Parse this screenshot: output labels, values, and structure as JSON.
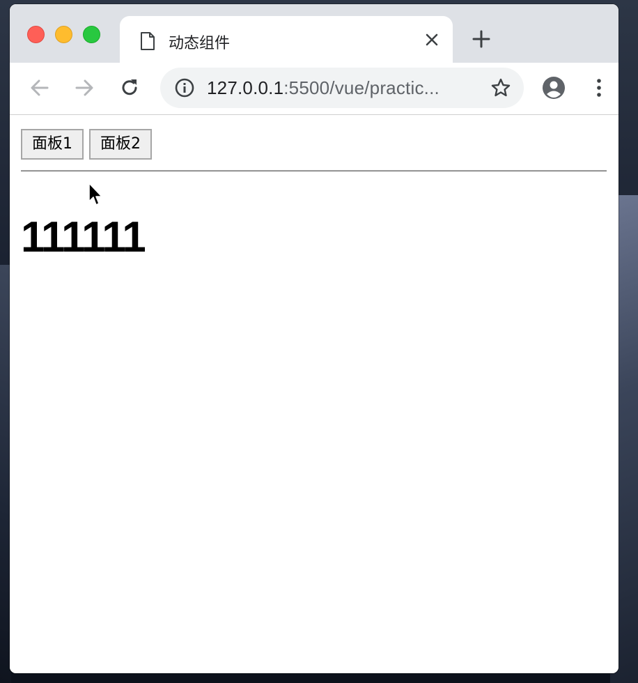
{
  "browser": {
    "tab_title": "动态组件",
    "url_host": "127.0.0.1",
    "url_path": ":5500/vue/practic...",
    "icons": {
      "back": "arrow-left-icon",
      "forward": "arrow-right-icon",
      "reload": "reload-icon",
      "info": "info-icon",
      "bookmark": "star-icon",
      "profile": "account-circle-icon",
      "menu": "kebab-menu-icon",
      "new_tab": "plus-icon",
      "close_tab": "close-icon",
      "favicon": "document-icon"
    }
  },
  "page": {
    "buttons": [
      {
        "label": "面板1"
      },
      {
        "label": "面板2"
      }
    ],
    "content_text": "111111"
  },
  "colors": {
    "traffic_red": "#fe5f57",
    "traffic_yellow": "#febc2e",
    "traffic_green": "#28c840",
    "tabstrip": "#dee1e6",
    "omnibox": "#f1f3f4"
  }
}
